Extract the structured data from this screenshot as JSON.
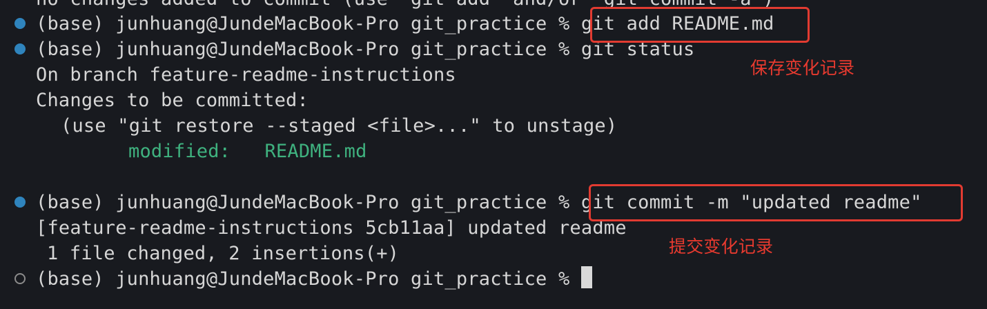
{
  "terminal": {
    "lines": {
      "partial_top": "no changes added to commit (use \"git add\" and/or \"git commit -a\")",
      "prompt1": "(base) junhuang@JundeMacBook-Pro git_practice % ",
      "cmd1": "git add README.md",
      "prompt2": "(base) junhuang@JundeMacBook-Pro git_practice % ",
      "cmd2": "git status",
      "on_branch": "On branch feature-readme-instructions",
      "changes": "Changes to be committed:",
      "hint": "(use \"git restore --staged <file>...\" to unstage)",
      "modified_label": "modified:   ",
      "modified_file": "README.md",
      "prompt3": "(base) junhuang@JundeMacBook-Pro git_practice % ",
      "cmd3": "git commit -m \"updated readme\"",
      "commit_result": "[feature-readme-instructions 5cb11aa] updated readme",
      "commit_stats": "1 file changed, 2 insertions(+)",
      "prompt4": "(base) junhuang@JundeMacBook-Pro git_practice % "
    }
  },
  "annotations": {
    "save_changes": "保存变化记录",
    "commit_changes": "提交变化记录"
  },
  "colors": {
    "background": "#181a1f",
    "text": "#d6d6d6",
    "modified": "#3fb27f",
    "prompt_dot": "#2f84bd",
    "highlight": "#e23b31"
  },
  "icons": {
    "prompt_marker": "filled-circle",
    "current_prompt_marker": "hollow-circle",
    "cursor": "block-cursor"
  }
}
